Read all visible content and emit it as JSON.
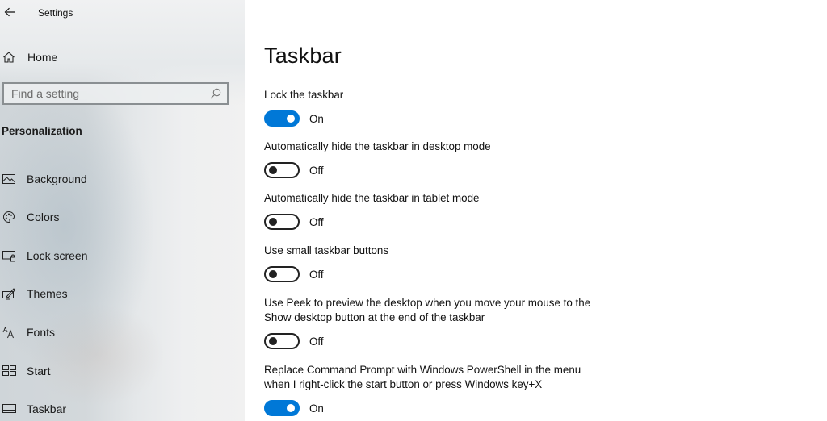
{
  "window": {
    "title": "Settings",
    "back_icon": "back-arrow-icon"
  },
  "sidebar": {
    "home": {
      "label": "Home",
      "icon": "home-icon"
    },
    "search": {
      "placeholder": "Find a setting",
      "value": "",
      "icon": "search-icon"
    },
    "section_title": "Personalization",
    "items": [
      {
        "label": "Background",
        "icon": "picture-icon"
      },
      {
        "label": "Colors",
        "icon": "palette-icon"
      },
      {
        "label": "Lock screen",
        "icon": "lock-screen-icon"
      },
      {
        "label": "Themes",
        "icon": "themes-brush-icon"
      },
      {
        "label": "Fonts",
        "icon": "fonts-icon"
      },
      {
        "label": "Start",
        "icon": "start-tiles-icon"
      },
      {
        "label": "Taskbar",
        "icon": "taskbar-icon"
      }
    ],
    "selected": "Taskbar"
  },
  "main": {
    "title": "Taskbar",
    "accent_color": "#0078d7",
    "settings": [
      {
        "desc_lines": [
          "Lock the taskbar"
        ],
        "state": "On",
        "on": true
      },
      {
        "desc_lines": [
          "Automatically hide the taskbar in desktop mode"
        ],
        "state": "Off",
        "on": false
      },
      {
        "desc_lines": [
          "Automatically hide the taskbar in tablet mode"
        ],
        "state": "Off",
        "on": false
      },
      {
        "desc_lines": [
          "Use small taskbar buttons"
        ],
        "state": "Off",
        "on": false
      },
      {
        "desc_lines": [
          "Use Peek to preview the desktop when you move your mouse to the",
          "Show desktop button at the end of the taskbar"
        ],
        "state": "Off",
        "on": false
      },
      {
        "desc_lines": [
          "Replace Command Prompt with Windows PowerShell in the menu",
          "when I right-click the start button or press Windows key+X"
        ],
        "state": "On",
        "on": true
      }
    ]
  }
}
